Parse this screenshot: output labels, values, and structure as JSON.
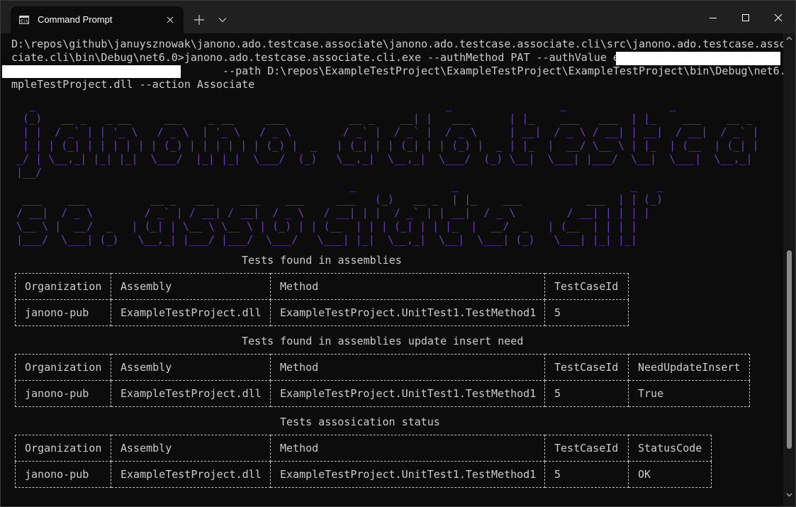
{
  "window": {
    "tab_title": "Command Prompt",
    "new_tab_symbol": "+"
  },
  "console": {
    "command_text": "D:\\repos\\github\\januysznowak\\janono.ado.testcase.associate\\janono.ado.testcase.associate.cli\\src\\janono.ado.testcase.asso\nciate.cli\\bin\\Debug\\net6.0>janono.ado.testcase.associate.cli.exe --authMethod PAT --authValue e\n                                 --path D:\\repos\\ExampleTestProject\\ExampleTestProject\\ExampleTestProject\\bin\\Debug\\net6.0\\Exa\nmpleTestProject.dll --action Associate",
    "banner_line1": "  _                                                                _                 _                _\n (_)   __ _   _ __     ___    _ __     ___          __ _    __| |   ___      | |_    ___   ___  | |_    ___    __ _\n | |  / _` | | '_ \\   / _ \\  | '_ \\   / _ \\        / _` |  / _` |  / _ \\     | __|  / _ \\ / __| | __|  / __|  / _` |\n | | | (_| | | | | | | (_) | | | | | | (_) |  _   | (_| | | (_| | | (_) |  _ | |_  |  __/ \\__ \\ | |_  | (__  | (_| |\n_/ | \\__,_| |_| |_|  \\___/  |_| |_|  \\___/  (_)   \\__,_|  \\__,_|  \\___/  (_) \\__|  \\___| |___/  \\__|  \\___|  \\__,_|\n|__/",
    "banner_line2": "                                                    _               _                           _   _\n ___    ___          __ _   ___    ___    ___     ___   (_)   __ _  | |_    ___          ___  | | (_)\n/ __|  / _ \\        / _` | / __| / __|  / _ \\   / __| | |  / _` | | __|  / _ \\        / __| | | | |\n\\__ \\ |  __/  _   | (_| | \\__ \\ \\__ \\ | (_) | | (__  | | | (_| | | |_  |  __/  _   | (__  | | | |\n|___/  \\___| (_)   \\__,_| |___/ |___/  \\___/   \\___| |_|  \\__,_|  \\__|  \\___| (_)   \\___| |_| |_|"
  },
  "tables": [
    {
      "caption": "Tests found in assemblies",
      "headers": [
        "Organization",
        "Assembly",
        "Method",
        "TestCaseId"
      ],
      "row": [
        "janono-pub",
        "ExampleTestProject.dll",
        "ExampleTestProject.UnitTest1.TestMethod1",
        "5"
      ]
    },
    {
      "caption": "Tests found in assemblies update insert need",
      "headers": [
        "Organization",
        "Assembly",
        "Method",
        "TestCaseId",
        "NeedUpdateInsert"
      ],
      "row": [
        "janono-pub",
        "ExampleTestProject.dll",
        "ExampleTestProject.UnitTest1.TestMethod1",
        "5",
        "True"
      ]
    },
    {
      "caption": "Tests assosication status",
      "headers": [
        "Organization",
        "Assembly",
        "Method",
        "TestCaseId",
        "StatusCode"
      ],
      "row": [
        "janono-pub",
        "ExampleTestProject.dll",
        "ExampleTestProject.UnitTest1.TestMethod1",
        "5",
        "OK"
      ]
    }
  ],
  "colors": {
    "terminal_bg": "#0c0c0c",
    "terminal_text": "#cccccc",
    "banner_purple": "#6b3fb6",
    "titlebar_bg": "#202020"
  },
  "icons": [
    "terminal-icon",
    "close-icon",
    "plus-icon",
    "chevron-down-icon",
    "minimize-icon",
    "maximize-icon",
    "window-close-icon",
    "scroll-up-icon",
    "scroll-down-icon"
  ]
}
